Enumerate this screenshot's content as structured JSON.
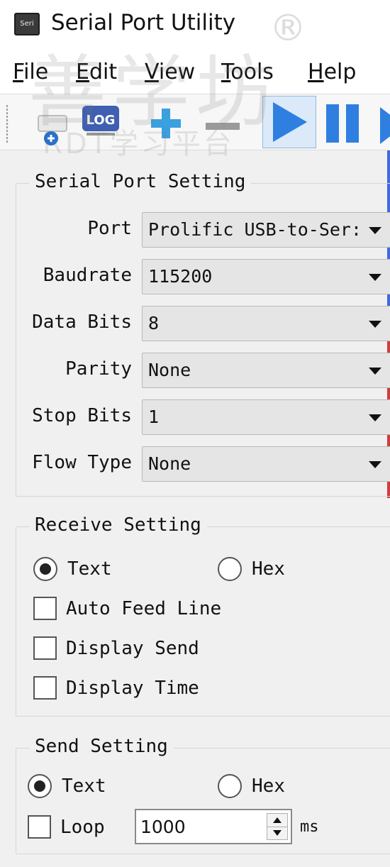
{
  "window": {
    "title": "Serial Port Utility",
    "app_icon_text": "Seri",
    "trademark": "®"
  },
  "watermark": {
    "text": "善学坊",
    "subtext": "RDT学习平台"
  },
  "menu": {
    "items": [
      {
        "label": "File",
        "mnemonic": "F",
        "rest": "ile"
      },
      {
        "label": "Edit",
        "mnemonic": "E",
        "rest": "dit"
      },
      {
        "label": "View",
        "mnemonic": "V",
        "rest": "iew"
      },
      {
        "label": "Tools",
        "mnemonic": "T",
        "rest": "ools"
      },
      {
        "label": "Help",
        "mnemonic": "H",
        "rest": "elp"
      }
    ]
  },
  "toolbar": {
    "log_label": "LOG",
    "icons": [
      "add-port-icon",
      "log-icon",
      "plus-icon",
      "minus-icon",
      "play-icon",
      "pause-icon",
      "next-icon"
    ],
    "colors": {
      "play": "#2f7fe0",
      "plus": "#3aa0e0",
      "minus": "#9a9a9a"
    }
  },
  "serial_port_setting": {
    "title": "Serial Port Setting",
    "fields": [
      {
        "label": "Port",
        "value": "Prolific USB-to-Ser:"
      },
      {
        "label": "Baudrate",
        "value": "115200"
      },
      {
        "label": "Data Bits",
        "value": "8"
      },
      {
        "label": "Parity",
        "value": "None"
      },
      {
        "label": "Stop Bits",
        "value": "1"
      },
      {
        "label": "Flow Type",
        "value": "None"
      }
    ]
  },
  "receive_setting": {
    "title": "Receive Setting",
    "text_label": "Text",
    "hex_label": "Hex",
    "selected": "Text",
    "auto_feed_line": "Auto Feed Line",
    "display_send": "Display Send",
    "display_time": "Display Time"
  },
  "send_setting": {
    "title": "Send Setting",
    "text_label": "Text",
    "hex_label": "Hex",
    "selected": "Text",
    "loop_label": "Loop",
    "interval_value": "1000",
    "interval_unit": "ms"
  }
}
